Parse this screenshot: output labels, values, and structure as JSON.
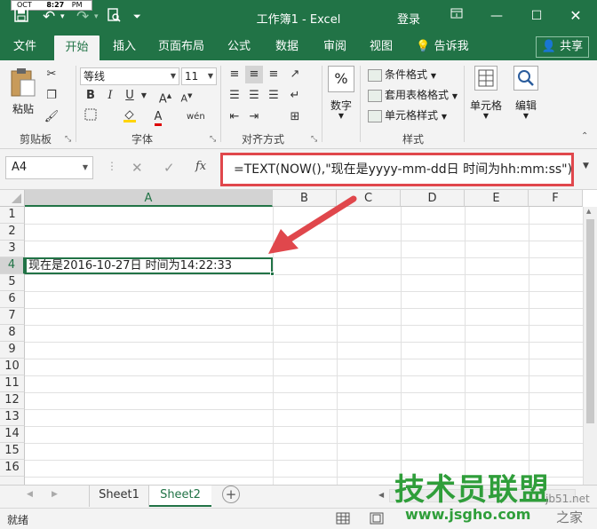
{
  "clock_overlay": {
    "top_text": "OCT",
    "time_text": "8:27",
    "ampm": "PM"
  },
  "titlebar": {
    "title": "工作簿1 - Excel",
    "login_label": "登录",
    "save_icon": "save-icon",
    "undo_icon": "undo-icon",
    "redo_icon": "redo-icon",
    "preview_icon": "print-preview-icon",
    "customize_icon": "customize-qat-icon"
  },
  "tabs": [
    {
      "label": "文件"
    },
    {
      "label": "开始"
    },
    {
      "label": "插入"
    },
    {
      "label": "页面布局"
    },
    {
      "label": "公式"
    },
    {
      "label": "数据"
    },
    {
      "label": "审阅"
    },
    {
      "label": "视图"
    },
    {
      "label": "告诉我"
    }
  ],
  "share_label": "共享",
  "ribbon": {
    "clipboard": {
      "paste_label": "粘贴",
      "group_label": "剪贴板"
    },
    "font": {
      "font_name": "等线",
      "font_size": "11",
      "group_label": "字体"
    },
    "alignment": {
      "group_label": "对齐方式"
    },
    "number": {
      "label": "数字",
      "symbol": "%"
    },
    "styles": {
      "conditional": "条件格式",
      "table_format": "套用表格格式",
      "cell_styles": "单元格样式",
      "group_label": "样式"
    },
    "cells": {
      "label": "单元格"
    },
    "editing": {
      "label": "编辑"
    }
  },
  "formula_bar": {
    "name_box": "A4",
    "fx_label": "fx",
    "formula": "=TEXT(NOW(),\"现在是yyyy-mm-dd日 时间为hh:mm:ss\")"
  },
  "grid": {
    "columns": [
      "A",
      "B",
      "C",
      "D",
      "E",
      "F"
    ],
    "rows": [
      "1",
      "2",
      "3",
      "4",
      "5",
      "6",
      "7",
      "8",
      "9",
      "10",
      "11",
      "12",
      "13",
      "14",
      "15",
      "16"
    ],
    "selected_cell": "A4",
    "cell_a4_value": "现在是2016-10-27日 时间为14:22:33"
  },
  "sheets": [
    {
      "name": "Sheet1"
    },
    {
      "name": "Sheet2"
    }
  ],
  "active_sheet": "Sheet2",
  "status": {
    "ready": "就绪"
  },
  "watermark": {
    "brand": "技术员联盟",
    "url": "www.jsgho.com",
    "small": "jb51.net",
    "tag": "之家"
  },
  "colors": {
    "excel_green": "#217346",
    "annotation_red": "#e0474c"
  }
}
